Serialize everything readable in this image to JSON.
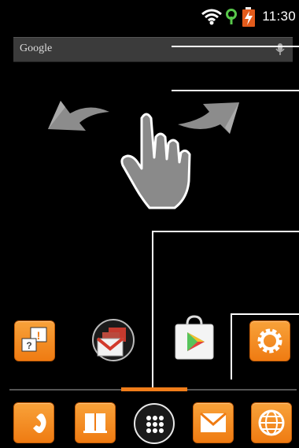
{
  "status_bar": {
    "time": "11:30",
    "icons": [
      "wifi-icon",
      "sync-icon",
      "battery-charging-icon"
    ]
  },
  "search_widget": {
    "label": "Google",
    "icon": "mic-icon"
  },
  "gesture_hint": {
    "icon": "swipe-hand-icon",
    "arrows": [
      "arrow-left-icon",
      "arrow-right-icon"
    ]
  },
  "apps": [
    {
      "name": "feedback",
      "icon": "feedback-icon"
    },
    {
      "name": "gmail",
      "icon": "gmail-icon"
    },
    {
      "name": "play-store",
      "icon": "play-store-icon"
    },
    {
      "name": "settings",
      "icon": "settings-icon"
    }
  ],
  "dock": [
    {
      "name": "phone",
      "icon": "phone-icon"
    },
    {
      "name": "contacts",
      "icon": "contacts-icon"
    },
    {
      "name": "app-drawer",
      "icon": "launcher-icon"
    },
    {
      "name": "messaging",
      "icon": "email-icon"
    },
    {
      "name": "browser",
      "icon": "browser-icon"
    }
  ],
  "colors": {
    "accent": "#f07d1a",
    "background": "#000000",
    "search_bar": "#3b3b3b"
  }
}
